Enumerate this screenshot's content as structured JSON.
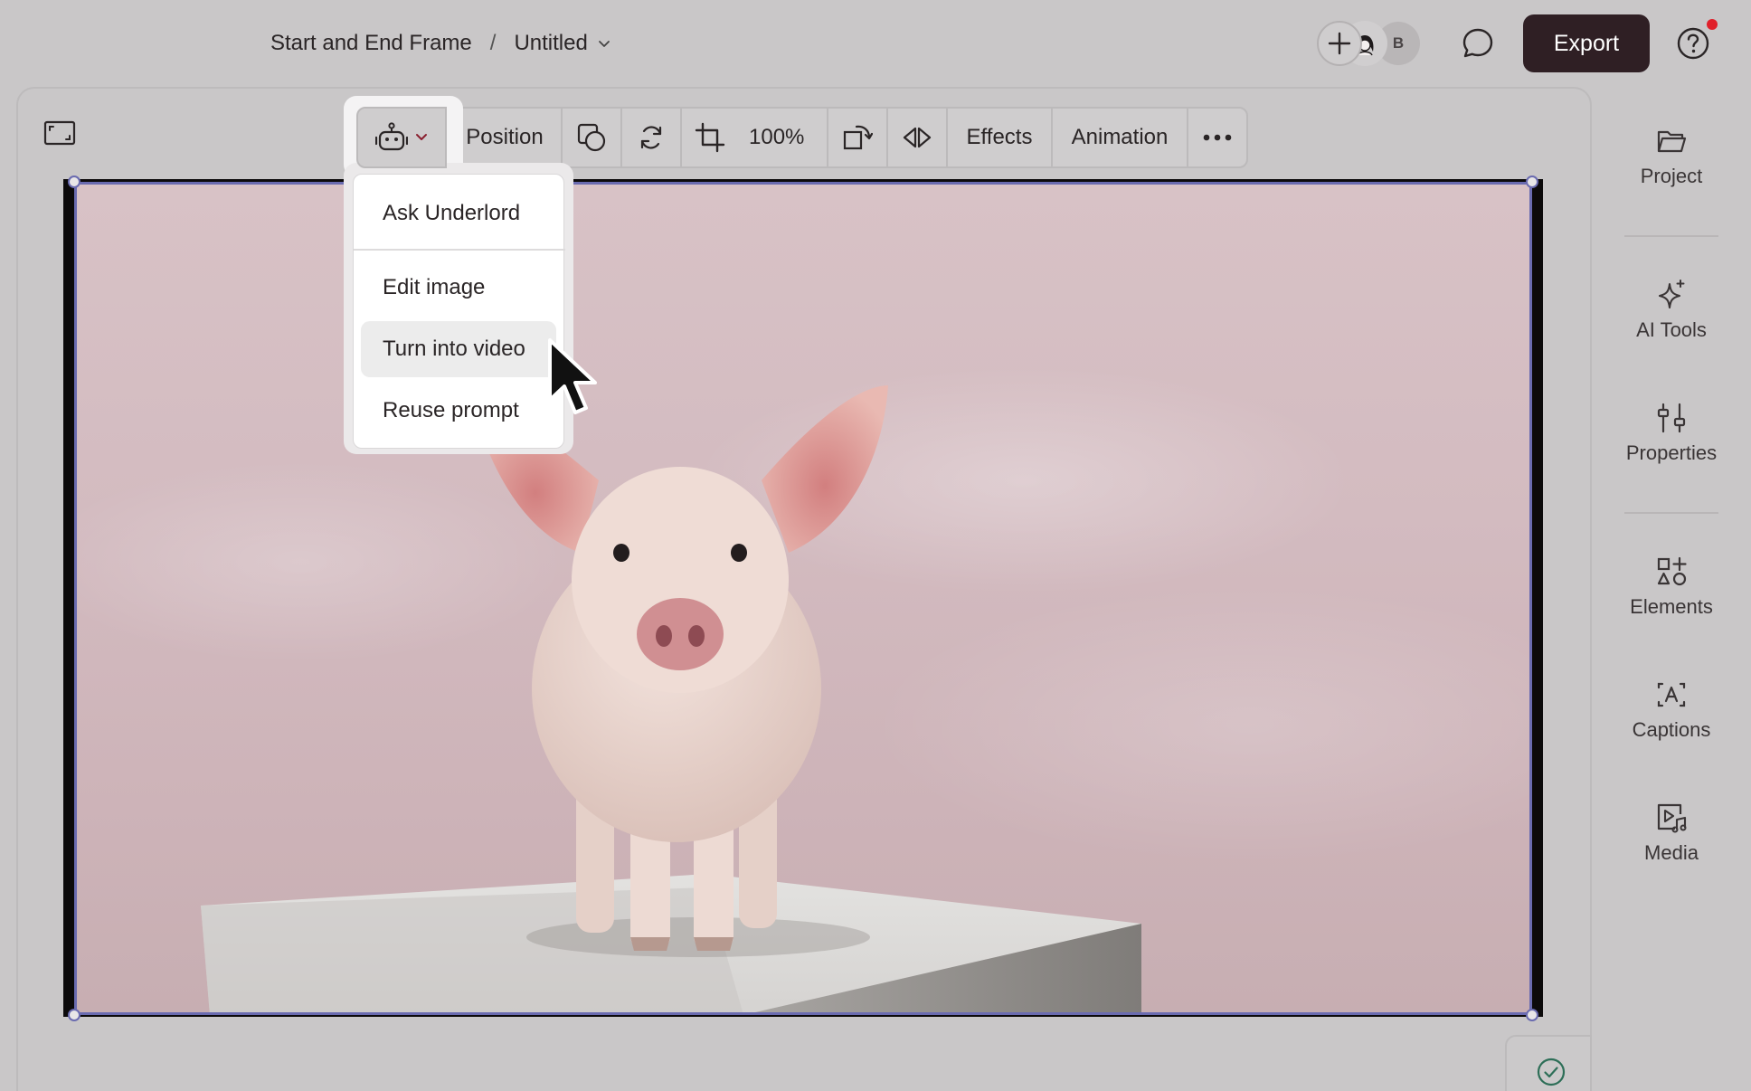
{
  "header": {
    "project_name": "Start and End Frame",
    "separator": "/",
    "doc_title": "Untitled",
    "collaborator_initial": "B",
    "export_label": "Export"
  },
  "toolbar": {
    "position_label": "Position",
    "zoom_value": "100%",
    "effects_label": "Effects",
    "animation_label": "Animation"
  },
  "ai_menu": {
    "items": [
      {
        "label": "Ask Underlord"
      },
      {
        "label": "Edit image"
      },
      {
        "label": "Turn into video"
      },
      {
        "label": "Reuse prompt"
      }
    ],
    "active_item": "Turn into video"
  },
  "sidebar": {
    "items": [
      {
        "label": "Project",
        "icon": "folder-icon"
      },
      {
        "label": "AI Tools",
        "icon": "sparkle-icon"
      },
      {
        "label": "Properties",
        "icon": "sliders-icon"
      },
      {
        "label": "Elements",
        "icon": "shapes-icon"
      },
      {
        "label": "Captions",
        "icon": "captions-icon"
      },
      {
        "label": "Media",
        "icon": "media-icon"
      }
    ]
  },
  "colors": {
    "accent_selection": "#6a6bb0",
    "export_bg": "#2f1f24",
    "notification": "#e0202a",
    "background": "#c9c7c8"
  }
}
